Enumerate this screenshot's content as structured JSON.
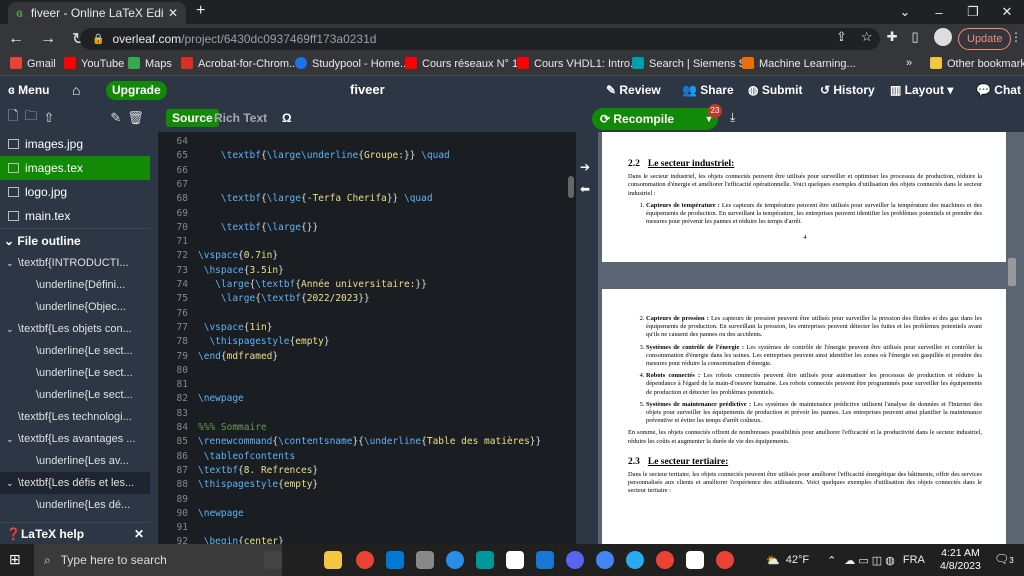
{
  "browser": {
    "tab_title": "fiveer - Online LaTeX Editor Over",
    "url_host": "overleaf.com",
    "url_path": "/project/6430dc0937469ff173a0231d",
    "update_label": "Update"
  },
  "bookmarks": [
    "Gmail",
    "YouTube",
    "Maps",
    "Acrobat-for-Chrom...",
    "Studypool - Home...",
    "Cours réseaux N° 1...",
    "Cours VHDL1: Intro...",
    "Search | Siemens S...",
    "Machine Learning...",
    "Other bookmarks"
  ],
  "bookmarks_more": "»",
  "header": {
    "menu": "Menu",
    "upgrade": "Upgrade",
    "project_title": "fiveer",
    "review": "Review",
    "share": "Share",
    "submit": "Submit",
    "history": "History",
    "layout": "Layout",
    "chat": "Chat"
  },
  "files": [
    {
      "name": "images.jpg",
      "selected": false
    },
    {
      "name": "images.tex",
      "selected": true
    },
    {
      "name": "logo.jpg",
      "selected": false
    },
    {
      "name": "main.tex",
      "selected": false
    }
  ],
  "outline": {
    "title": "File outline",
    "items": [
      {
        "text": "\\textbf{INTRODUCTI...",
        "level": 0,
        "chev": "v"
      },
      {
        "text": "\\underline{Défini...",
        "level": 1
      },
      {
        "text": "\\underline{Objec...",
        "level": 1
      },
      {
        "text": "\\textbf{Les objets con...",
        "level": 0,
        "chev": "v"
      },
      {
        "text": "\\underline{Le sect...",
        "level": 1
      },
      {
        "text": "\\underline{Le sect...",
        "level": 1
      },
      {
        "text": "\\underline{Le sect...",
        "level": 1
      },
      {
        "text": "\\textbf{Les technologi...",
        "level": 0
      },
      {
        "text": "\\textbf{Les avantages ...",
        "level": 0,
        "chev": "v"
      },
      {
        "text": "\\underline{Les av...",
        "level": 1
      },
      {
        "text": "\\textbf{Les défis et les...",
        "level": 0,
        "chev": "v",
        "active": true
      },
      {
        "text": "\\underline{Les dé...",
        "level": 1
      },
      {
        "text": "\\underline{Les lim...",
        "level": 1
      }
    ]
  },
  "help_label": "LaTeX help",
  "editor": {
    "source_tab": "Source",
    "rich_tab": "Rich Text",
    "symbol": "Ω",
    "lines": [
      {
        "n": "64",
        "t": ""
      },
      {
        "n": "65",
        "t": "    \\textbf{\\large\\underline{Groupe:}} \\quad"
      },
      {
        "n": "66",
        "t": ""
      },
      {
        "n": "67",
        "t": ""
      },
      {
        "n": "68",
        "t": "    \\textbf{\\large{-Terfa Cherifa}} \\quad"
      },
      {
        "n": "69",
        "t": ""
      },
      {
        "n": "70",
        "t": "    \\textbf{\\large{}}"
      },
      {
        "n": "71",
        "t": ""
      },
      {
        "n": "72",
        "t": "\\vspace{0.7in}"
      },
      {
        "n": "73",
        "t": " \\hspace{3.5in}"
      },
      {
        "n": "74",
        "t": "   \\large{\\textbf{Année universitaire:}}"
      },
      {
        "n": "75",
        "t": "    \\large{\\textbf{2022/2023}}"
      },
      {
        "n": "76",
        "t": ""
      },
      {
        "n": "77",
        "t": " \\vspace{1in}"
      },
      {
        "n": "78",
        "t": "  \\thispagestyle{empty}"
      },
      {
        "n": "79",
        "t": "\\end{mdframed}"
      },
      {
        "n": "80",
        "t": ""
      },
      {
        "n": "81",
        "t": ""
      },
      {
        "n": "82",
        "t": "\\newpage"
      },
      {
        "n": "83",
        "t": ""
      },
      {
        "n": "84",
        "t": "%%% Sommaire"
      },
      {
        "n": "85",
        "t": "\\renewcommand{\\contentsname}{\\underline{Table des matières}}"
      },
      {
        "n": "86",
        "t": " \\tableofcontents"
      },
      {
        "n": "87",
        "t": "\\textbf{8. Refrences}"
      },
      {
        "n": "88",
        "t": "\\thispagestyle{empty}"
      },
      {
        "n": "89",
        "t": ""
      },
      {
        "n": "90",
        "t": "\\newpage"
      },
      {
        "n": "91",
        "t": ""
      },
      {
        "n": "92",
        "t": " \\begin{center}"
      }
    ]
  },
  "pdf": {
    "recompile": "Recompile",
    "badge": "23",
    "page1": {
      "sec_num": "2.2",
      "sec_title": "Le secteur industriel:",
      "intro": "Dans le secteur industriel, les objets connectés peuvent être utilisés pour surveiller et optimiser les processus de production, réduire la consommation d'énergie et améliorer l'efficacité opérationnelle. Voici quelques exemples d'utilisation des objets connectés dans le secteur industriel :",
      "item1_title": "Capteurs de température :",
      "item1_text": "Les capteurs de température peuvent être utilisés pour surveiller la température des machines et des équipements de production. En surveillant la température, les entreprises peuvent identifier les problèmes potentiels et prendre des mesures pour prévenir les pannes et réduire les temps d'arrêt.",
      "page_number": "4"
    },
    "page2": {
      "items": [
        {
          "title": "Capteurs de pression :",
          "text": "Les capteurs de pression peuvent être utilisés pour surveiller la pression des fluides et des gaz dans les équipements de production. En surveillant la pression, les entreprises peuvent détecter les fuites et les problèmes potentiels avant qu'ils ne causent des pannes ou des accidents."
        },
        {
          "title": "Systèmes de contrôle de l'énergie :",
          "text": "Les systèmes de contrôle de l'énergie peuvent être utilisés pour surveiller et contrôler la consommation d'énergie dans les usines. Les entreprises peuvent ainsi identifier les zones où l'énergie est gaspillée et prendre des mesures pour réduire la consommation d'énergie."
        },
        {
          "title": "Robots connectés :",
          "text": "Les robots connectés peuvent être utilisés pour automatiser les processus de production et réduire la dépendance à l'égard de la main-d'oeuvre humaine. Les robots connectés peuvent être programmés pour surveiller les équipements de production et détecter les problèmes potentiels."
        },
        {
          "title": "Systèmes de maintenance prédictive :",
          "text": "Les systèmes de maintenance prédictive utilisent l'analyse de données et l'Internet des objets pour surveiller les équipements de production et prévoir les pannes. Les entreprises peuvent ainsi planifier la maintenance préventive et éviter les temps d'arrêt coûteux."
        }
      ],
      "summary": "En somme, les objets connectés offrent de nombreuses possibilités pour améliorer l'efficacité et la productivité dans le secteur industriel, réduire les coûts et augmenter la durée de vie des équipements.",
      "sec_num": "2.3",
      "sec_title": "Le secteur tertiaire:",
      "sec_text": "Dans le secteur tertiaire, les objets connectés peuvent être utilisés pour améliorer l'efficacité énergétique des bâtiments, offrir des services personnalisés aux clients et améliorer l'expérience des utilisateurs. Voici quelques exemples d'utilisation des objets connectés dans le secteur tertiaire :"
    }
  },
  "taskbar": {
    "search_placeholder": "Type here to search",
    "weather": "42°F",
    "lang": "FRA",
    "time": "4:21 AM",
    "date": "4/8/2023",
    "notif": "3"
  },
  "colors": {
    "accent": "#138a07",
    "header": "#2c3645",
    "editor_bg": "#1a1d21"
  }
}
